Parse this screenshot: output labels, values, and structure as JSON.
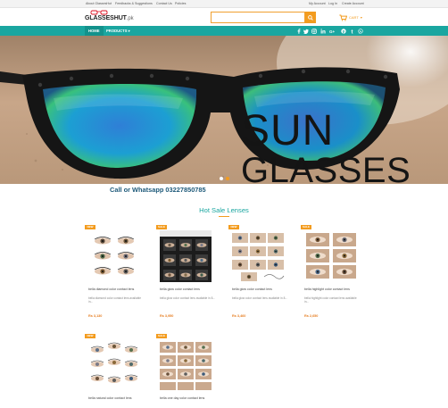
{
  "topbar": {
    "links": [
      "About GlassesHut",
      "Feedbacks & Suggestions",
      "Contact Us",
      "Policies"
    ],
    "account_links": [
      "My Account",
      "Log In",
      "Create Account"
    ]
  },
  "header": {
    "logo_main": "GLASSESHUT",
    "logo_suffix": ".pk",
    "search_placeholder": "",
    "cart_label": "CART"
  },
  "nav": {
    "home": "HOME",
    "products": "PRODUCTS",
    "social_icons": [
      "facebook-icon",
      "twitter-icon",
      "instagram-icon",
      "linkedin-icon",
      "google-plus-icon",
      "pinterest-icon",
      "tumblr-icon",
      "whatsapp-icon"
    ]
  },
  "hero": {
    "line1": "SUN",
    "line2": "GLASSES"
  },
  "call_text": "Call or Whatsapp 03227850785",
  "section_title": "Hot Sale Lenses",
  "colors": {
    "teal": "#1aa6a0",
    "orange": "#f39c1f",
    "price": "#e67e22"
  },
  "products": [
    {
      "badge": "NEW",
      "name": "bella diamond color contact lens",
      "desc": "bella diamond color contact lens available in...",
      "price": "Rs 3,130"
    },
    {
      "badge": "SALE",
      "name": "bella glow color contact lens",
      "desc": "bella glow color contact lens available in 8...",
      "price": "Rs 3,950"
    },
    {
      "badge": "NEW",
      "name": "bella glow color contact lens",
      "desc": "bella glow color contact lens available in 8...",
      "price": "Rs 3,460"
    },
    {
      "badge": "SALE",
      "name": "bella highlight color contact lens",
      "desc": "bella highlight color contact lens available in...",
      "price": "Rs 2,650"
    },
    {
      "badge": "NEW",
      "name": "bella natural color contact lens",
      "desc": "",
      "price": ""
    },
    {
      "badge": "SALE",
      "name": "bella one day color contact lens",
      "desc": "",
      "price": ""
    }
  ]
}
